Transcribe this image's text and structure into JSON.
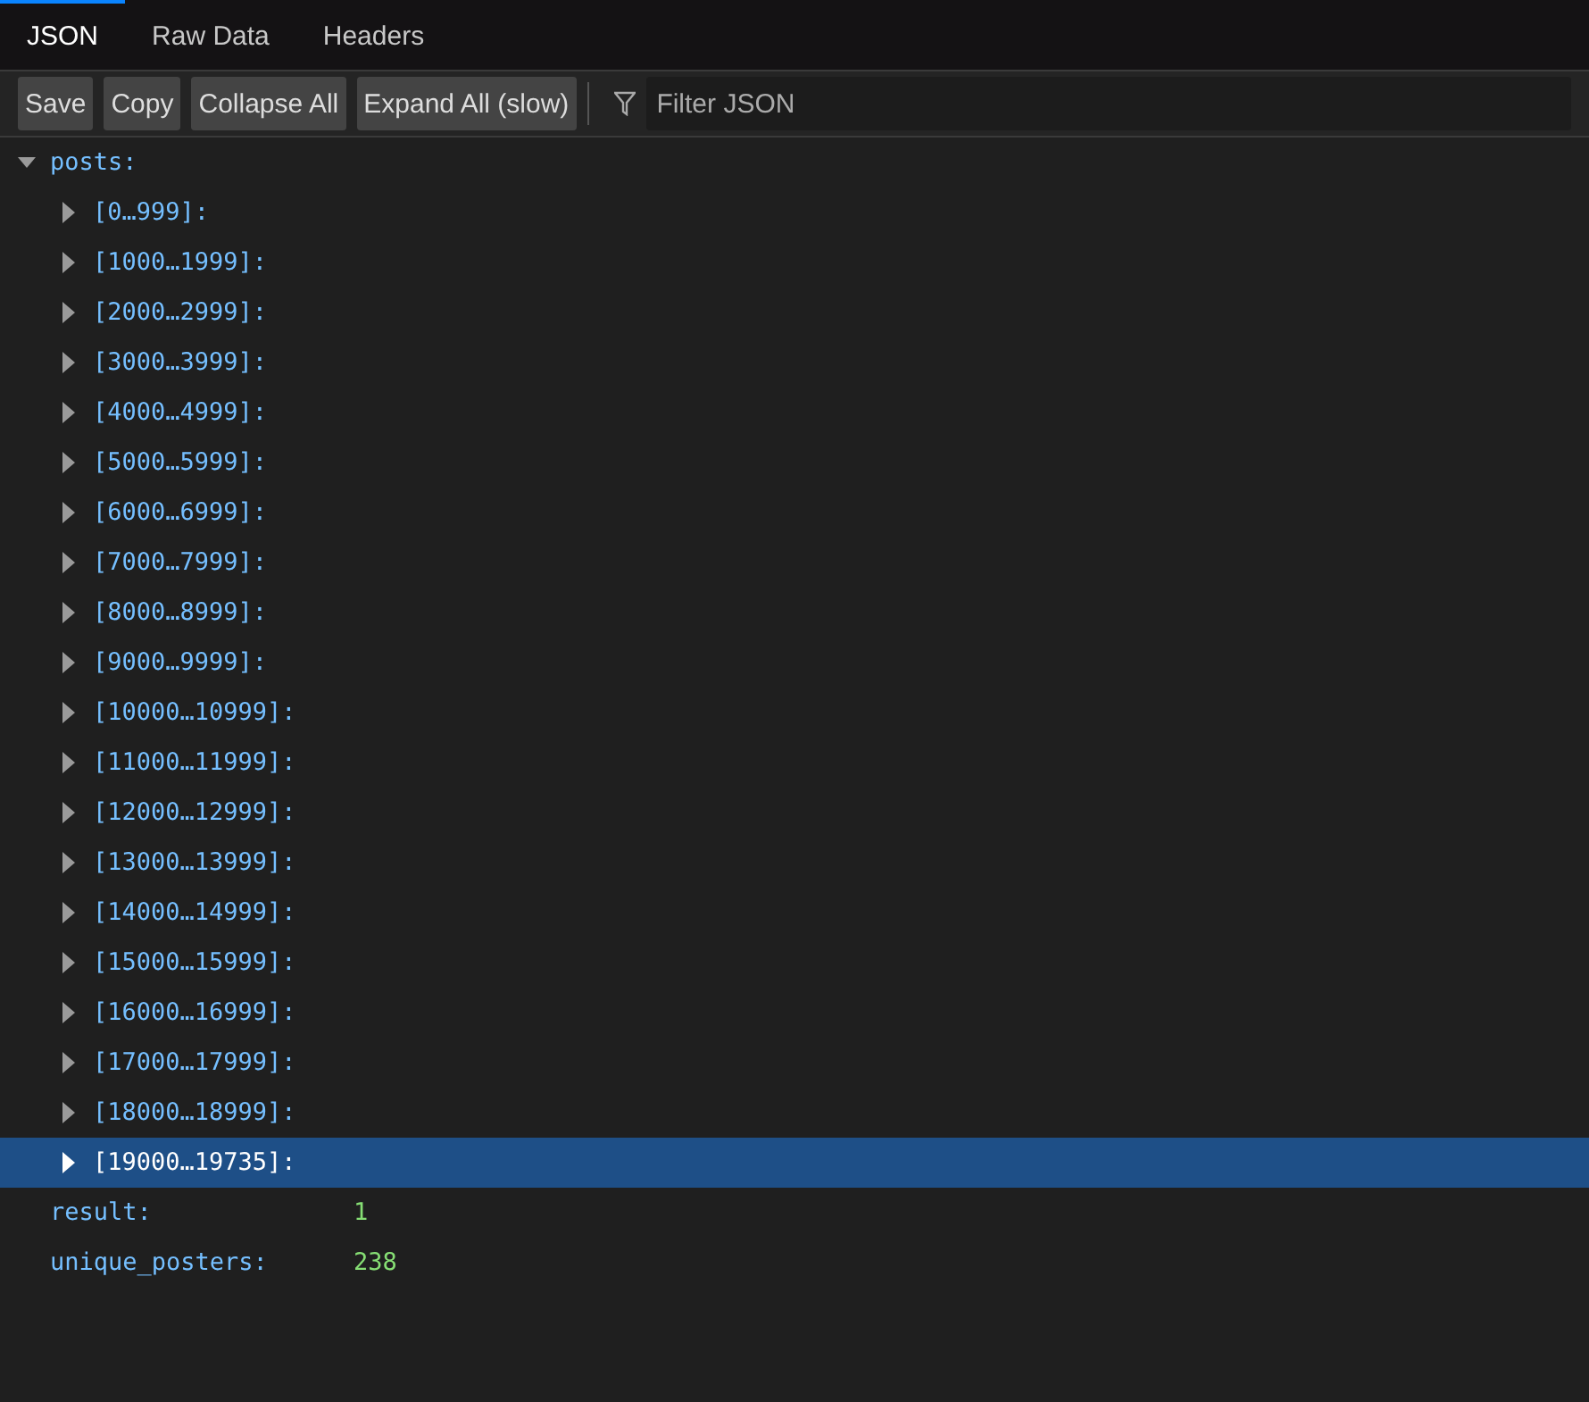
{
  "tabs": [
    {
      "label": "JSON",
      "selected": true
    },
    {
      "label": "Raw Data",
      "selected": false
    },
    {
      "label": "Headers",
      "selected": false
    }
  ],
  "toolbar": {
    "buttons": [
      "Save",
      "Copy",
      "Collapse All",
      "Expand All (slow)"
    ],
    "filter": {
      "placeholder": "Filter JSON"
    }
  },
  "tree": [
    {
      "key": "posts:",
      "expanded": true,
      "selected": false,
      "children": [
        {
          "key": "[0…999]:",
          "expanded": false,
          "selected": false
        },
        {
          "key": "[1000…1999]:",
          "expanded": false,
          "selected": false
        },
        {
          "key": "[2000…2999]:",
          "expanded": false,
          "selected": false
        },
        {
          "key": "[3000…3999]:",
          "expanded": false,
          "selected": false
        },
        {
          "key": "[4000…4999]:",
          "expanded": false,
          "selected": false
        },
        {
          "key": "[5000…5999]:",
          "expanded": false,
          "selected": false
        },
        {
          "key": "[6000…6999]:",
          "expanded": false,
          "selected": false
        },
        {
          "key": "[7000…7999]:",
          "expanded": false,
          "selected": false
        },
        {
          "key": "[8000…8999]:",
          "expanded": false,
          "selected": false
        },
        {
          "key": "[9000…9999]:",
          "expanded": false,
          "selected": false
        },
        {
          "key": "[10000…10999]:",
          "expanded": false,
          "selected": false
        },
        {
          "key": "[11000…11999]:",
          "expanded": false,
          "selected": false
        },
        {
          "key": "[12000…12999]:",
          "expanded": false,
          "selected": false
        },
        {
          "key": "[13000…13999]:",
          "expanded": false,
          "selected": false
        },
        {
          "key": "[14000…14999]:",
          "expanded": false,
          "selected": false
        },
        {
          "key": "[15000…15999]:",
          "expanded": false,
          "selected": false
        },
        {
          "key": "[16000…16999]:",
          "expanded": false,
          "selected": false
        },
        {
          "key": "[17000…17999]:",
          "expanded": false,
          "selected": false
        },
        {
          "key": "[18000…18999]:",
          "expanded": false,
          "selected": false
        },
        {
          "key": "[19000…19735]:",
          "expanded": false,
          "selected": true
        }
      ]
    },
    {
      "key": "result:",
      "value": "1",
      "selected": false
    },
    {
      "key": "unique_posters:",
      "value": "238",
      "selected": false
    }
  ]
}
